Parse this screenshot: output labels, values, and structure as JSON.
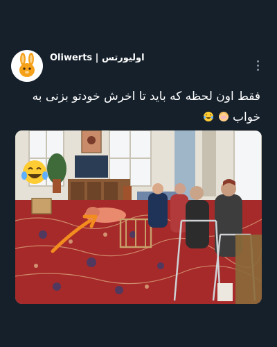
{
  "tweet": {
    "display_name": "Oliwerts | اولیورتس",
    "text": "فقط اون لحظه که باید تا اخرش خودتو بزنی به خواب",
    "emojis": [
      "face-with-tears-of-joy-icon",
      "woman-facepalming-icon"
    ],
    "avatar_icon": "orange-bunny-icon",
    "more_icon": "more-options-icon"
  },
  "media": {
    "description_icons": [
      "face-with-tears-of-joy-icon",
      "orange-arrow-icon"
    ]
  },
  "colors": {
    "background": "#15202b",
    "text": "#ffffff",
    "muted": "#8b98a5",
    "arrow": "#f28c1f"
  }
}
